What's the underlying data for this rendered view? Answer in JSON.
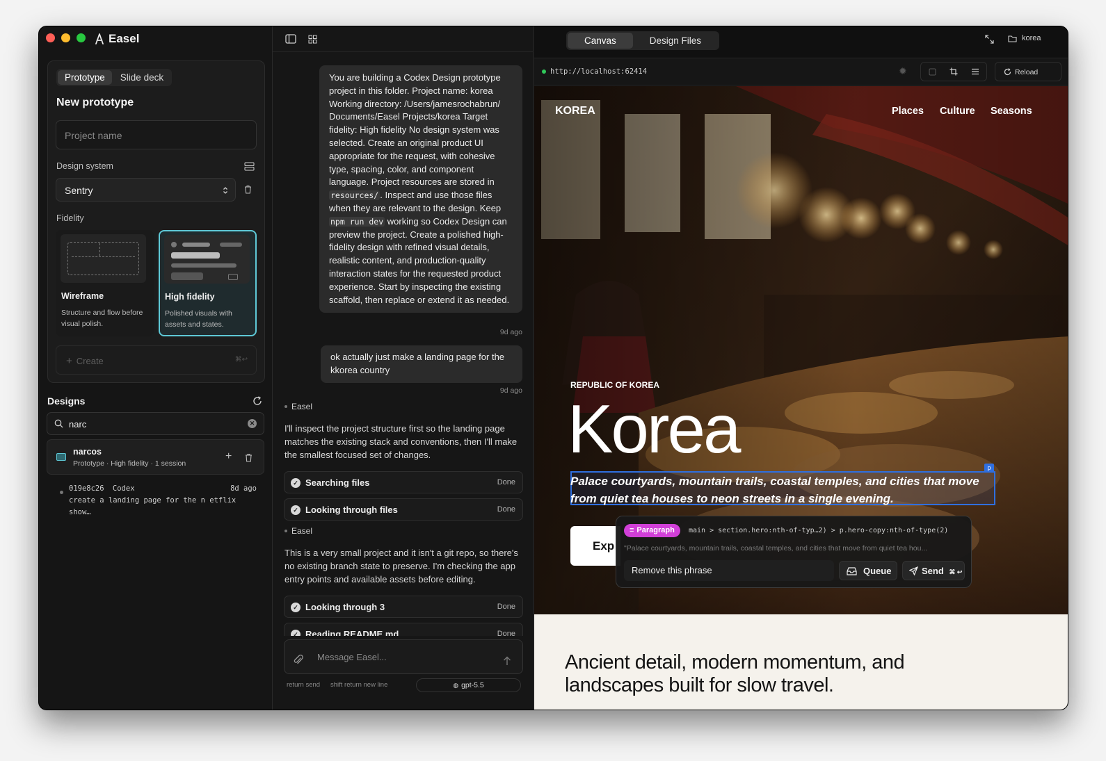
{
  "app": {
    "title": "Easel"
  },
  "left": {
    "mode_tabs": [
      "Prototype",
      "Slide deck"
    ],
    "heading": "New prototype",
    "project_name_placeholder": "Project name",
    "design_system_label": "Design system",
    "design_system_value": "Sentry",
    "fidelity_label": "Fidelity",
    "fidelity_options": [
      {
        "title": "Wireframe",
        "desc": "Structure and flow before visual polish."
      },
      {
        "title": "High fidelity",
        "desc": "Polished visuals with assets and states."
      }
    ],
    "create_label": "Create",
    "create_shortcut": "⌘↩",
    "designs_heading": "Designs",
    "search_value": "narc",
    "design_item": {
      "name": "narcos",
      "meta": "Prototype · High fidelity · 1 session"
    },
    "session": {
      "id": "019e8c26",
      "agent": "Codex",
      "age": "8d ago",
      "summary": "create a landing page for the n etflix show…"
    }
  },
  "chat": {
    "messages": [
      {
        "pre1": "You are building a Codex Design prototype project in this folder. Project name: korea Working directory: /Users/jamesrochabrun/ Documents/Easel Projects/korea Target fidelity: High fidelity No design system was selected. Create an original product UI appropriate for the request, with cohesive type, spacing, color, and component language. Project resources are stored in ",
        "code1": "resources/",
        "mid1": ". Inspect and use those files when they are relevant to the design. Keep ",
        "code2": "npm run dev",
        "post1": " working so Codex Design can preview the project. Create a polished high-fidelity design with refined visual details, realistic content, and production-quality interaction states for the requested product experience. Start by inspecting the existing scaffold, then replace or extend it as needed.",
        "time": "9d ago"
      },
      {
        "text": "ok actually just make a landing page for the kkorea country",
        "time": "9d ago"
      }
    ],
    "agent_name": "Easel",
    "reply1": "I'll inspect the project structure first so the landing page matches the existing stack and conventions, then I'll make the smallest focused set of changes.",
    "steps1": [
      {
        "name": "Searching files",
        "status": "Done"
      },
      {
        "name": "Looking through files",
        "status": "Done"
      }
    ],
    "reply2": "This is a very small project and it isn't a git repo, so there's no existing branch state to preserve. I'm checking the app entry points and available assets before editing.",
    "steps2": [
      {
        "name": "Looking through 3",
        "status": "Done"
      },
      {
        "name": "Reading README.md",
        "status": "Done"
      }
    ],
    "composer_placeholder": "Message Easel...",
    "hint_send": "return send",
    "hint_newline": "shift return new line",
    "model": "gpt-5.5"
  },
  "preview": {
    "tabs": [
      "Canvas",
      "Design Files"
    ],
    "project": "korea",
    "url": "http://localhost:62414",
    "reload_label": "Reload",
    "site": {
      "brand": "KOREA",
      "nav": [
        "Places",
        "Culture",
        "Seasons"
      ],
      "kicker": "REPUBLIC OF KOREA",
      "title": "Korea",
      "copy": "Palace courtyards, mountain trails, coastal temples, and cities that move from quiet tea houses to neon streets in a single evening.",
      "cta": "Exp",
      "section_heading_1": "Ancient detail, modern momentum, and",
      "section_heading_2": "landscapes built for slow travel."
    },
    "inspector": {
      "badge": "Paragraph",
      "selector": "main > section.hero:nth-of-typ…2) > p.hero-copy:nth-of-type(2)",
      "quote": "\"Palace courtyards, mountain trails, coastal temples, and cities that move from quiet tea hou...",
      "input_value": "Remove this phrase",
      "queue_label": "Queue",
      "send_label": "Send",
      "send_shortcut": "⌘ ↩",
      "handle": "p"
    }
  },
  "colors": {
    "accent": "#5ec8d6",
    "selection": "#2f6fe0",
    "badge": "#d13fd8"
  }
}
